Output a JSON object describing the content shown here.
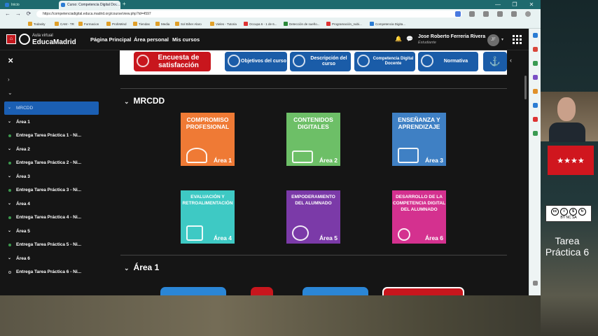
{
  "browser": {
    "tabs": [
      {
        "label": "Inicio"
      },
      {
        "label": "Curso: Competencia Digital Doc..."
      }
    ],
    "new_tab": "+",
    "window_controls": [
      "—",
      "❐",
      "✕"
    ],
    "nav": {
      "back": "←",
      "forward": "→",
      "reload": "⟳"
    },
    "url": "https://competenciadigital.educa.madrid.org/course/view.php?id=4597",
    "bookmarks": [
      "Todasity",
      "CAM - TR",
      "Formacion",
      "ProfeMind",
      "Tiendas",
      "Media",
      "Sol Biher Alaro",
      "Vieles - Tutoria",
      "Occupa 6 - 1 de 6...",
      "Detección de sueño...",
      "Programación_nubi...",
      "Competencia Digita..."
    ]
  },
  "colors": {
    "accent": "#1b5fb3",
    "brand_red": "#c3171d",
    "green_dot": "#3c9a4e"
  },
  "navbar": {
    "logo_top": "Aula virtual",
    "brand": "EducaMadrid",
    "links": [
      "Página Principal",
      "Área personal",
      "Mis cursos"
    ],
    "icons": {
      "bell": "bell-icon",
      "chat": "chat-icon",
      "apps": "apps-grid-icon"
    },
    "user_name": "Jose Roberto Ferreria Rivera",
    "user_role": "Estudiante",
    "avatar": "JF"
  },
  "sidebar": {
    "close": "✕",
    "chevrons": [
      "›",
      "⌄"
    ],
    "items": [
      {
        "label": "MRCDD",
        "type": "section",
        "selected": true
      },
      {
        "label": "Área 1",
        "type": "section"
      },
      {
        "label": "Entrega Tarea Práctica 1 - Ni...",
        "type": "activity"
      },
      {
        "label": "Área 2",
        "type": "section"
      },
      {
        "label": "Entrega Tarea Práctica 2 - Ni...",
        "type": "activity"
      },
      {
        "label": "Área 3",
        "type": "section"
      },
      {
        "label": "Entrega Tarea Práctica 3 - Ni...",
        "type": "activity"
      },
      {
        "label": "Área 4",
        "type": "section"
      },
      {
        "label": "Entrega Tarea Práctica 4 - Ni...",
        "type": "activity"
      },
      {
        "label": "Área 5",
        "type": "section"
      },
      {
        "label": "Entrega Tarea Práctica 5 - Ni...",
        "type": "activity"
      },
      {
        "label": "Área 6",
        "type": "section"
      },
      {
        "label": "Entrega Tarea Práctica 6 - Ni...",
        "type": "activity-open"
      }
    ]
  },
  "banner": {
    "buttons": [
      {
        "label": "Encuesta de satisfacción",
        "color": "#c8161d"
      },
      {
        "label": "Objetivos del curso",
        "color": "#1a5ca8"
      },
      {
        "label": "Descripción del curso",
        "color": "#1a5ca8"
      },
      {
        "label": "Competencia Digital Docente",
        "color": "#1a5ca8"
      },
      {
        "label": "Normativa",
        "color": "#1a5ca8"
      },
      {
        "label": "⚓",
        "color": "#1a5ca8"
      }
    ]
  },
  "sections": {
    "mrcdd": "MRCDD",
    "area1": "Área 1"
  },
  "tiles": [
    {
      "title": "COMPROMISO PROFESIONAL",
      "area": "Área 1",
      "color": "#ef7a35"
    },
    {
      "title": "CONTENIDOS DIGITALES",
      "area": "Área 2",
      "color": "#6dbf67"
    },
    {
      "title": "ENSEÑANZA Y APRENDIZAJE",
      "area": "Área 3",
      "color": "#3f80c4"
    },
    {
      "title": "EVALUACIÓN Y RETROALIMENTACIÓN",
      "area": "Área 4",
      "color": "#3ec9c4"
    },
    {
      "title": "EMPODERAMIENTO DEL ALUMNADO",
      "area": "Área 5",
      "color": "#7b3aa8"
    },
    {
      "title": "DESARROLLO DE LA COMPETENCIA DIGITAL DEL ALUMNADO",
      "area": "Área 6",
      "color": "#d4318f"
    }
  ],
  "overlay": {
    "license": "BY NC SA",
    "task_label": "Tarea Práctica 6"
  }
}
